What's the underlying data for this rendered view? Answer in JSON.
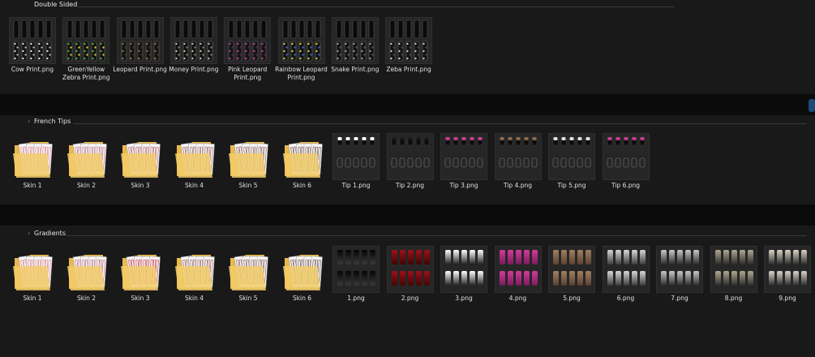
{
  "sections": [
    {
      "title": "Double Sided",
      "items": [
        {
          "label": "Cow Print.png",
          "kind": "double",
          "colors": [
            "#e8e8e8",
            "#bfbfbf"
          ]
        },
        {
          "label": "GreenYellow Zebra Print.png",
          "kind": "double",
          "colors": [
            "#45c437",
            "#e8e23a"
          ]
        },
        {
          "label": "Leopard Print.png",
          "kind": "double",
          "colors": [
            "#9a7446",
            "#4a3218"
          ]
        },
        {
          "label": "Money Print.png",
          "kind": "double",
          "colors": [
            "#c9c9b8",
            "#8c8c7a"
          ]
        },
        {
          "label": "Pink Leopard Print.png",
          "kind": "double",
          "colors": [
            "#d23c9c",
            "#6a1a4e"
          ]
        },
        {
          "label": "Rainbow Leopard Print.png",
          "kind": "double",
          "colors": [
            "#e0e040",
            "#3a6ad0"
          ]
        },
        {
          "label": "Snake Print.png",
          "kind": "double",
          "colors": [
            "#a8a8a8",
            "#5c5c5c"
          ]
        },
        {
          "label": "Zeba Print.png",
          "kind": "double",
          "colors": [
            "#d8d8d8",
            "#4a4a4a"
          ]
        }
      ]
    },
    {
      "title": "French Tips",
      "items": [
        {
          "label": "Skin 1",
          "kind": "folder",
          "colors": [
            "#d46f7a"
          ]
        },
        {
          "label": "Skin 2",
          "kind": "folder",
          "colors": [
            "#b05a74"
          ]
        },
        {
          "label": "Skin 3",
          "kind": "folder",
          "colors": [
            "#a84a5a"
          ]
        },
        {
          "label": "Skin 4",
          "kind": "folder",
          "colors": [
            "#8a4a4a"
          ]
        },
        {
          "label": "Skin 5",
          "kind": "folder",
          "colors": [
            "#7a4a46"
          ]
        },
        {
          "label": "Skin 6",
          "kind": "folder",
          "colors": [
            "#5a3c3a"
          ]
        },
        {
          "label": "Tip 1.png",
          "kind": "tip",
          "colors": [
            "#ffffff"
          ]
        },
        {
          "label": "Tip 2.png",
          "kind": "tip",
          "colors": [
            "#151515"
          ]
        },
        {
          "label": "Tip 3.png",
          "kind": "tip",
          "colors": [
            "#c83c94"
          ]
        },
        {
          "label": "Tip 4.png",
          "kind": "tip",
          "colors": [
            "#8a6a4a"
          ]
        },
        {
          "label": "Tip 5.png",
          "kind": "tip",
          "colors": [
            "#e0e0e0"
          ]
        },
        {
          "label": "Tip 6.png",
          "kind": "tip",
          "colors": [
            "#c83c94"
          ]
        }
      ]
    },
    {
      "title": "Gradients",
      "items": [
        {
          "label": "Skin 1",
          "kind": "folder",
          "colors": [
            "#d46f7a"
          ]
        },
        {
          "label": "Skin 2",
          "kind": "folder",
          "colors": [
            "#b05a74"
          ]
        },
        {
          "label": "Skin 3",
          "kind": "folder",
          "colors": [
            "#c02030"
          ]
        },
        {
          "label": "Skin 4",
          "kind": "folder",
          "colors": [
            "#8a4a4a"
          ]
        },
        {
          "label": "Skin 5",
          "kind": "folder",
          "colors": [
            "#7a4a46"
          ]
        },
        {
          "label": "Skin 6",
          "kind": "folder",
          "colors": [
            "#5a3c3a"
          ]
        },
        {
          "label": "1.png",
          "kind": "grad",
          "colors": [
            "#050505",
            "#3a3a3a"
          ]
        },
        {
          "label": "2.png",
          "kind": "grad",
          "colors": [
            "#a01018",
            "#400606"
          ]
        },
        {
          "label": "3.png",
          "kind": "grad",
          "colors": [
            "#ffffff",
            "#202020"
          ]
        },
        {
          "label": "4.png",
          "kind": "grad",
          "colors": [
            "#d23c9c",
            "#7a1a5a"
          ]
        },
        {
          "label": "5.png",
          "kind": "grad",
          "colors": [
            "#a08060",
            "#5a4030"
          ]
        },
        {
          "label": "6.png",
          "kind": "grad",
          "colors": [
            "#d8d8d8",
            "#3a3a3a"
          ]
        },
        {
          "label": "7.png",
          "kind": "grad",
          "colors": [
            "#c8c8c8",
            "#2a2a2a"
          ]
        },
        {
          "label": "8.png",
          "kind": "grad",
          "colors": [
            "#b0a890",
            "#2a2a2a"
          ]
        },
        {
          "label": "9.png",
          "kind": "grad",
          "colors": [
            "#d8d4c8",
            "#2a2a2a"
          ]
        }
      ]
    }
  ]
}
